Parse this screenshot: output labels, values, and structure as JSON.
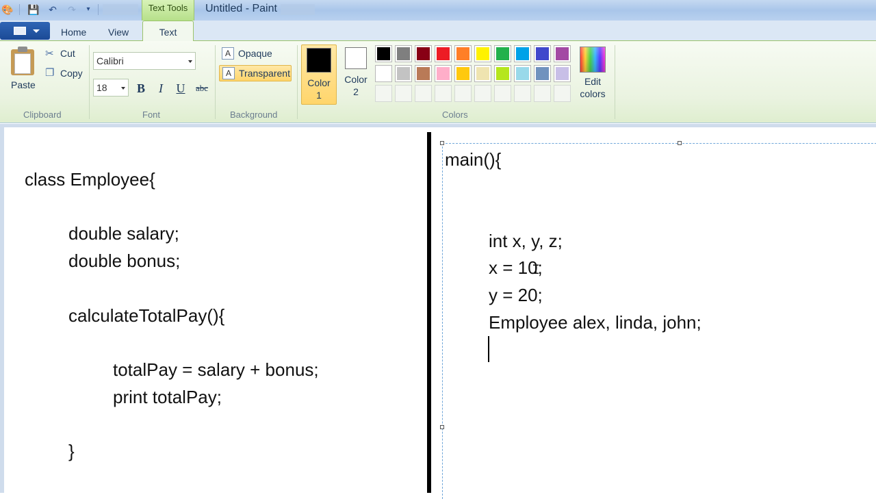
{
  "window": {
    "title": "Untitled - Paint",
    "context_tab": "Text Tools"
  },
  "ribbon_tabs": [
    "Home",
    "View",
    "Text"
  ],
  "clipboard": {
    "paste": "Paste",
    "cut": "Cut",
    "copy": "Copy",
    "group": "Clipboard"
  },
  "font": {
    "family": "Calibri",
    "size": "18",
    "bold": "B",
    "italic": "I",
    "underline": "U",
    "strike": "abc",
    "group": "Font"
  },
  "background": {
    "opaque": "Opaque",
    "transparent": "Transparent",
    "group": "Background",
    "selected": "Transparent"
  },
  "colors": {
    "color1_label": "Color\n1",
    "color1_value": "#000000",
    "color2_label": "Color\n2",
    "color2_value": "#ffffff",
    "edit": "Edit colors",
    "group": "Colors",
    "palette_row1": [
      "#000000",
      "#7f7f7f",
      "#880015",
      "#ed1c24",
      "#ff7f27",
      "#fff200",
      "#22b14c",
      "#00a2e8",
      "#3f48cc",
      "#a349a4"
    ],
    "palette_row2": [
      "#ffffff",
      "#c3c3c3",
      "#b97a57",
      "#ffaec9",
      "#ffc90e",
      "#efe4b0",
      "#b5e61d",
      "#99d9ea",
      "#7092be",
      "#c8bfe7"
    ]
  },
  "canvas": {
    "left_code": [
      "class Employee{",
      "double salary;",
      "double bonus;",
      "calculateTotalPay(){",
      "totalPay = salary + bonus;",
      "print totalPay;",
      "}"
    ],
    "right_code": [
      "main(){",
      "int x, y, z;",
      "x = 10;",
      "y = 20;",
      "Employee alex, linda, john;"
    ]
  }
}
